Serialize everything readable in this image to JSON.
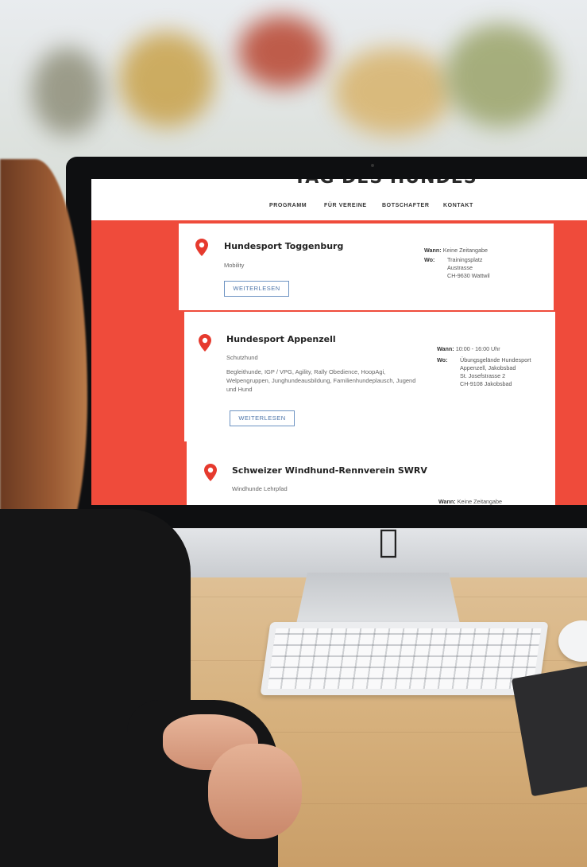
{
  "site": {
    "logo_partial": "TAG DES HUNDES",
    "nav": [
      "PROGRAMM",
      "FÜR VEREINE",
      "BOTSCHAFTER",
      "KONTAKT"
    ]
  },
  "cards": [
    {
      "title": "Hundesport Toggenburg",
      "subtitle": "Mobility",
      "description": "",
      "button": "WEITERLESEN",
      "when_label": "Wann:",
      "when": "Keine Zeitangabe",
      "where_label": "Wo:",
      "where": [
        "Trainingsplatz",
        "Austrasse",
        "CH-9630 Wattwil"
      ]
    },
    {
      "title": "Hundesport Appenzell",
      "subtitle": "Schutzhund",
      "description": "Begleithunde, IGP / VPG, Agility, Rally Obedience, HoopAgi, Welpengruppen, Junghundeausbildung, Familienhundeplausch, Jugend und Hund",
      "button": "WEITERLESEN",
      "when_label": "Wann:",
      "when": "10:00 - 16:00 Uhr",
      "where_label": "Wo:",
      "where": [
        "Übungsgelände Hundesport",
        "Appenzell, Jakobsbad",
        "St. Josefstrasse 2",
        "CH-9108 Jakobsbad"
      ]
    },
    {
      "title": "Schweizer Windhund-Rennverein SWRV",
      "subtitle": "Windhunde Lehrpfad",
      "when_label": "Wann:",
      "when": "Keine Zeitangabe"
    }
  ],
  "colors": {
    "brand_red": "#ef4b3b",
    "button_blue": "#4a73a8"
  },
  "icons": [
    "map-pin-icon",
    "apple-logo-icon"
  ]
}
